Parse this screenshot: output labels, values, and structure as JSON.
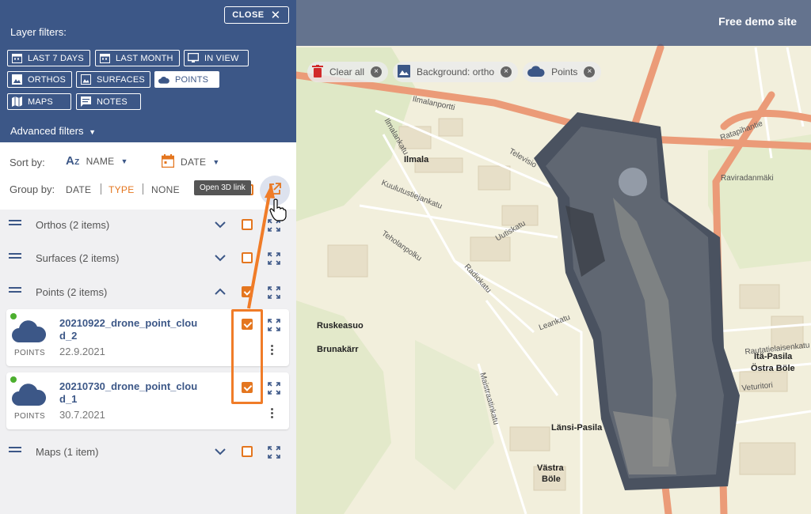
{
  "sidebar": {
    "close_label": "CLOSE",
    "layer_filters_title": "Layer filters:",
    "filters": [
      {
        "label": "LAST 7 DAYS",
        "icon": "calendar-icon",
        "active": false
      },
      {
        "label": "LAST MONTH",
        "icon": "calendar-icon",
        "active": false
      },
      {
        "label": "IN VIEW",
        "icon": "monitor-icon",
        "active": false
      },
      {
        "label": "ORTHOS",
        "icon": "image-icon",
        "active": false
      },
      {
        "label": "SURFACES",
        "icon": "image-icon",
        "active": false
      },
      {
        "label": "POINTS",
        "icon": "cloud-icon",
        "active": true
      },
      {
        "label": "MAPS",
        "icon": "map-icon",
        "active": false
      },
      {
        "label": "NOTES",
        "icon": "note-icon",
        "active": false
      }
    ],
    "advanced_filters": "Advanced filters",
    "sort_by_label": "Sort by:",
    "sort_name": "NAME",
    "sort_date": "DATE",
    "group_by_label": "Group by:",
    "group_options": [
      "DATE",
      "TYPE",
      "NONE"
    ],
    "group_selected": "TYPE",
    "tooltip": "Open 3D link",
    "groups": [
      {
        "name": "Orthos (2 items)",
        "expanded": false,
        "checked": false
      },
      {
        "name": "Surfaces (2 items)",
        "expanded": false,
        "checked": false
      },
      {
        "name": "Points (2 items)",
        "expanded": true,
        "checked": true
      },
      {
        "name": "Maps (1 item)",
        "expanded": false,
        "checked": false
      }
    ],
    "items": [
      {
        "name": "20210922_drone_point_cloud_2",
        "type": "POINTS",
        "date": "22.9.2021",
        "checked": true,
        "status_color": "#4caf2f"
      },
      {
        "name": "20210730_drone_point_cloud_1",
        "type": "POINTS",
        "date": "30.7.2021",
        "checked": true,
        "status_color": "#4caf2f"
      }
    ]
  },
  "map": {
    "site_title": "Free demo site",
    "chips": [
      {
        "label": "Clear all",
        "icon": "trash-icon"
      },
      {
        "label": "Background: ortho",
        "icon": "image-icon"
      },
      {
        "label": "Points",
        "icon": "cloud-icon"
      }
    ],
    "labels": [
      "Ilmala",
      "Ruskeasuo",
      "Brunakärr",
      "Länsi-Pasila",
      "Västra",
      "Böle",
      "Itä-Pasila",
      "Östra Böle",
      "Ilmalanportti",
      "Ilmalankatu",
      "Kuulutustiejankatu",
      "Teholanpolku",
      "Uutiskatu",
      "Televisio",
      "Radiokatu",
      "Ratapihantie",
      "Rautatielaisenkatu",
      "Veturitori",
      "Raviradanmäki",
      "Leankatu",
      "Maistraatinkatu"
    ]
  },
  "colors": {
    "sidebar_top": "#3c5787",
    "accent": "#e4761f",
    "status_ok": "#4caf2f"
  }
}
